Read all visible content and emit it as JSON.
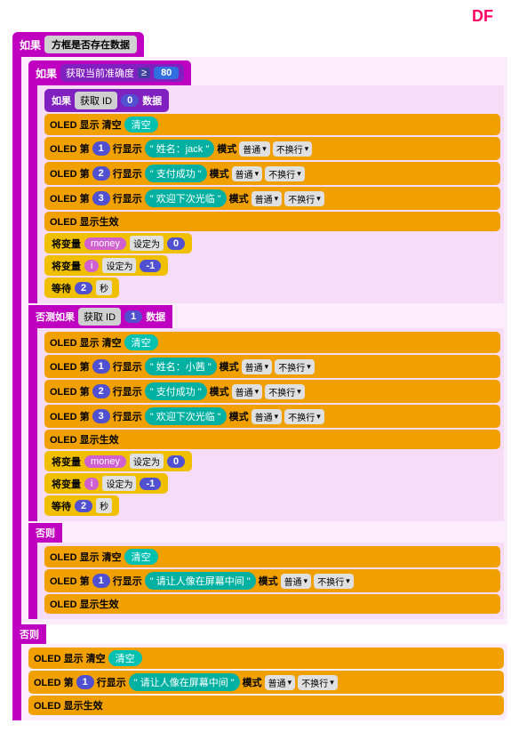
{
  "df_label": "DF",
  "top_if": {
    "label": "如果",
    "condition": "方框是否存在数据"
  },
  "inner_if": {
    "label": "如果",
    "accuracy_label": "获取当前准确度",
    "op": "≥",
    "value": "80"
  },
  "inner_if2": {
    "label": "如果",
    "get_id_label": "获取 ID",
    "id_val": "0",
    "data_label": "数据"
  },
  "oled_blocks": {
    "clear": "OLED 显示 清空",
    "show_effect": "OLED 显示生效",
    "row_label": "OLED 第",
    "show_label": "行显示",
    "mode_label": "模式",
    "mode_val": "普通",
    "nowrap_label": "不换行"
  },
  "jack_block": {
    "row": "1",
    "text": "\" 姓名：jack \"",
    "mode": "普通",
    "nowrap": "不换行"
  },
  "payment1_block": {
    "row": "2",
    "text": "\" 支付成功 \"",
    "mode": "普通",
    "nowrap": "不换行"
  },
  "welcome1_block": {
    "row": "3",
    "text": "\" 欢迎下次光临 \"",
    "mode": "普通",
    "nowrap": "不换行"
  },
  "money_set": {
    "label": "将变量",
    "var": "money",
    "set_label": "设定为",
    "val": "0"
  },
  "i_set": {
    "label": "将变量",
    "var": "i",
    "set_label": "设定为",
    "val": "-1"
  },
  "wait1": {
    "label": "等待",
    "val": "2",
    "unit": "秒"
  },
  "elseif_block": {
    "label": "否测如果",
    "get_id_label": "获取 ID",
    "id_val": "1",
    "data_label": "数据"
  },
  "xiao_block": {
    "row": "1",
    "text": "\" 姓名：小茜 \"",
    "mode": "普通",
    "nowrap": "不换行"
  },
  "payment2_block": {
    "row": "2",
    "text": "\" 支付成功 \"",
    "mode": "普通",
    "nowrap": "不换行"
  },
  "welcome2_block": {
    "row": "3",
    "text": "\" 欢迎下次光临 \"",
    "mode": "普通",
    "nowrap": "不换行"
  },
  "money_set2": {
    "label": "将变量",
    "var": "money",
    "set_label": "设定为",
    "val": "0"
  },
  "i_set2": {
    "label": "将变量",
    "var": "i",
    "set_label": "设定为",
    "val": "-1"
  },
  "wait2": {
    "label": "等待",
    "val": "2",
    "unit": "秒"
  },
  "else_inner": {
    "label": "否则",
    "face_text": "\" 请让人像在屏幕中间 \"",
    "row": "1",
    "mode": "普通",
    "nowrap": "不换行"
  },
  "else_outer": {
    "label": "否则",
    "face_text": "\" 请让人像在屏幕中间 \"",
    "row": "1",
    "mode": "普通",
    "nowrap": "不换行"
  }
}
